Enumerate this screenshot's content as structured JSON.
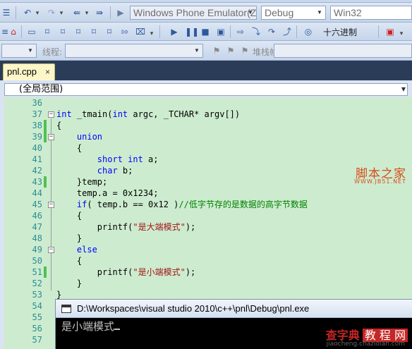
{
  "toolbar1": {
    "emulator_combo": "Windows Phone Emulator(ZH-",
    "config_combo": "Debug",
    "platform_combo": "Win32"
  },
  "toolbar2": {
    "hex_label": "十六进制"
  },
  "toolbar3": {
    "thread_label": "线程:",
    "stack_label": "堆栈帧:"
  },
  "tab": {
    "filename": "pnl.cpp",
    "close_glyph": "×"
  },
  "scope_combo": "(全局范围)",
  "editor": {
    "line_numbers": [
      "36",
      "37",
      "38",
      "39",
      "40",
      "41",
      "42",
      "43",
      "44",
      "45",
      "46",
      "47",
      "48",
      "49",
      "50",
      "51",
      "52",
      "53",
      "54",
      "55",
      "56",
      "57"
    ],
    "lines": [
      "",
      "int _tmain(int argc, _TCHAR* argv[])",
      "{",
      "    union",
      "    {",
      "        short int a;",
      "        char b;",
      "    }temp;",
      "    temp.a = 0x1234;",
      "    if( temp.b == 0x12 )//低字节存的是数据的高字节数据",
      "    {",
      "        printf(\"是大端模式\");",
      "    }",
      "    else",
      "    {",
      "        printf(\"是小端模式\");",
      "    }",
      "}",
      "",
      "",
      "",
      ""
    ]
  },
  "console": {
    "title": "D:\\Workspaces\\visual studio 2010\\c++\\pnl\\Debug\\pnl.exe",
    "output": "是小端模式"
  },
  "watermarks": {
    "jb51_name": "脚本之家",
    "jb51_site": "WWW.JB51.NET",
    "chazidian_name": "查字典",
    "chazidian_badge": "教 程 网",
    "chazidian_site": "jiaocheng.chazidian.com"
  }
}
